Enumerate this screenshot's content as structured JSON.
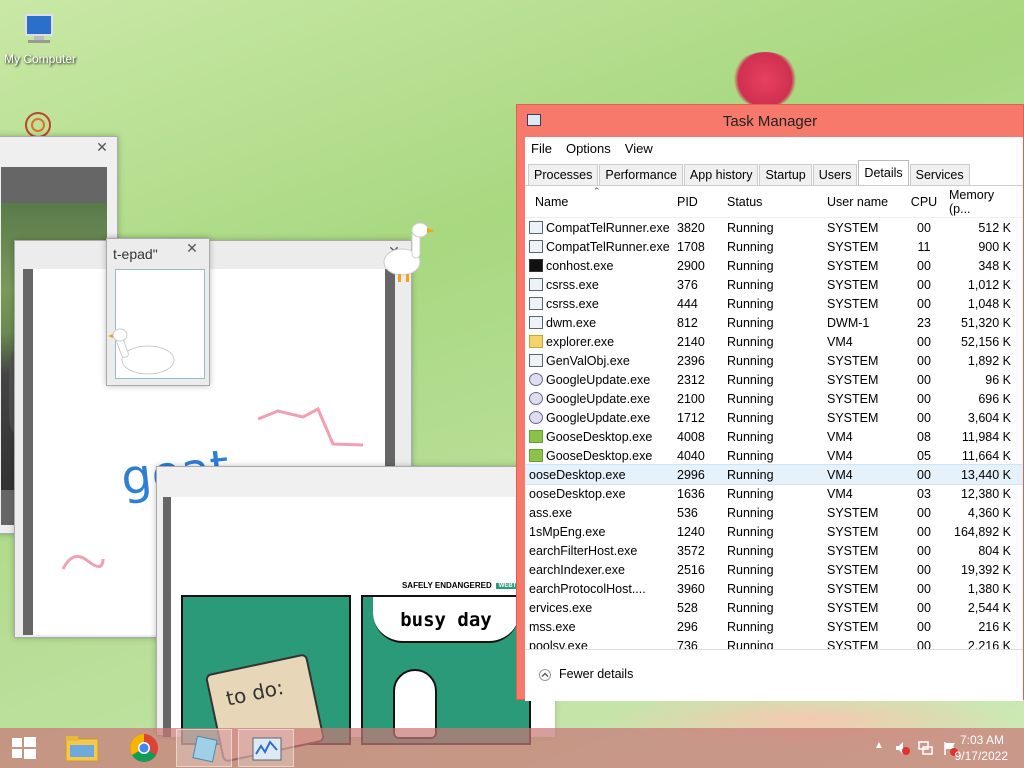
{
  "desktop": {
    "icons": [
      {
        "label": "My Computer",
        "icon": "computer-icon"
      }
    ]
  },
  "notepad_window": {
    "title_fragment": "t-epad\""
  },
  "task_manager": {
    "title": "Task Manager",
    "menu": [
      "File",
      "Options",
      "View"
    ],
    "tabs": [
      "Processes",
      "Performance",
      "App history",
      "Startup",
      "Users",
      "Details",
      "Services"
    ],
    "active_tab": "Details",
    "columns": [
      "Name",
      "PID",
      "Status",
      "User name",
      "CPU",
      "Memory (p..."
    ],
    "rows": [
      {
        "name": "CompatTelRunner.exe",
        "pid": "3820",
        "status": "Running",
        "user": "SYSTEM",
        "cpu": "00",
        "mem": "512 K",
        "icon": "generic"
      },
      {
        "name": "CompatTelRunner.exe",
        "pid": "1708",
        "status": "Running",
        "user": "SYSTEM",
        "cpu": "11",
        "mem": "900 K",
        "icon": "generic"
      },
      {
        "name": "conhost.exe",
        "pid": "2900",
        "status": "Running",
        "user": "SYSTEM",
        "cpu": "00",
        "mem": "348 K",
        "icon": "cmd"
      },
      {
        "name": "csrss.exe",
        "pid": "376",
        "status": "Running",
        "user": "SYSTEM",
        "cpu": "00",
        "mem": "1,012 K",
        "icon": "generic"
      },
      {
        "name": "csrss.exe",
        "pid": "444",
        "status": "Running",
        "user": "SYSTEM",
        "cpu": "00",
        "mem": "1,048 K",
        "icon": "generic"
      },
      {
        "name": "dwm.exe",
        "pid": "812",
        "status": "Running",
        "user": "DWM-1",
        "cpu": "23",
        "mem": "51,320 K",
        "icon": "generic"
      },
      {
        "name": "explorer.exe",
        "pid": "2140",
        "status": "Running",
        "user": "VM4",
        "cpu": "00",
        "mem": "52,156 K",
        "icon": "explorer"
      },
      {
        "name": "GenValObj.exe",
        "pid": "2396",
        "status": "Running",
        "user": "SYSTEM",
        "cpu": "00",
        "mem": "1,892 K",
        "icon": "generic"
      },
      {
        "name": "GoogleUpdate.exe",
        "pid": "2312",
        "status": "Running",
        "user": "SYSTEM",
        "cpu": "00",
        "mem": "96 K",
        "icon": "gu"
      },
      {
        "name": "GoogleUpdate.exe",
        "pid": "2100",
        "status": "Running",
        "user": "SYSTEM",
        "cpu": "00",
        "mem": "696 K",
        "icon": "gu"
      },
      {
        "name": "GoogleUpdate.exe",
        "pid": "1712",
        "status": "Running",
        "user": "SYSTEM",
        "cpu": "00",
        "mem": "3,604 K",
        "icon": "gu"
      },
      {
        "name": "GooseDesktop.exe",
        "pid": "4008",
        "status": "Running",
        "user": "VM4",
        "cpu": "08",
        "mem": "11,984 K",
        "icon": "goose"
      },
      {
        "name": "GooseDesktop.exe",
        "pid": "4040",
        "status": "Running",
        "user": "VM4",
        "cpu": "05",
        "mem": "11,664 K",
        "icon": "goose"
      },
      {
        "name": "ooseDesktop.exe",
        "pid": "2996",
        "status": "Running",
        "user": "VM4",
        "cpu": "00",
        "mem": "13,440 K",
        "icon": "none",
        "selected": true
      },
      {
        "name": "ooseDesktop.exe",
        "pid": "1636",
        "status": "Running",
        "user": "VM4",
        "cpu": "03",
        "mem": "12,380 K",
        "icon": "none"
      },
      {
        "name": "ass.exe",
        "pid": "536",
        "status": "Running",
        "user": "SYSTEM",
        "cpu": "00",
        "mem": "4,360 K",
        "icon": "none"
      },
      {
        "name": "1sMpEng.exe",
        "pid": "1240",
        "status": "Running",
        "user": "SYSTEM",
        "cpu": "00",
        "mem": "164,892 K",
        "icon": "none"
      },
      {
        "name": "earchFilterHost.exe",
        "pid": "3572",
        "status": "Running",
        "user": "SYSTEM",
        "cpu": "00",
        "mem": "804 K",
        "icon": "none"
      },
      {
        "name": "earchIndexer.exe",
        "pid": "2516",
        "status": "Running",
        "user": "SYSTEM",
        "cpu": "00",
        "mem": "19,392 K",
        "icon": "none"
      },
      {
        "name": "earchProtocolHost....",
        "pid": "3960",
        "status": "Running",
        "user": "SYSTEM",
        "cpu": "00",
        "mem": "1,380 K",
        "icon": "none"
      },
      {
        "name": "ervices.exe",
        "pid": "528",
        "status": "Running",
        "user": "SYSTEM",
        "cpu": "00",
        "mem": "2,544 K",
        "icon": "none"
      },
      {
        "name": "mss.exe",
        "pid": "296",
        "status": "Running",
        "user": "SYSTEM",
        "cpu": "00",
        "mem": "216 K",
        "icon": "none"
      },
      {
        "name": "poolsv.exe",
        "pid": "736",
        "status": "Running",
        "user": "SYSTEM",
        "cpu": "00",
        "mem": "2,216 K",
        "icon": "none"
      }
    ],
    "footer_label": "Fewer details"
  },
  "comic_window": {
    "header_text": "SAFELY ENDANGERED",
    "badge": "WEBTOON",
    "panel1_text": "to do:",
    "panel2_text": "busy day"
  },
  "notepad_drawing": {
    "text": "geat"
  },
  "taskbar": {
    "clock_time": "7:03 AM",
    "clock_date": "9/17/2022"
  },
  "colors": {
    "task_manager_frame": "#f6796b",
    "comic_green": "#2a9a78",
    "selection": "#e5f1fb"
  }
}
